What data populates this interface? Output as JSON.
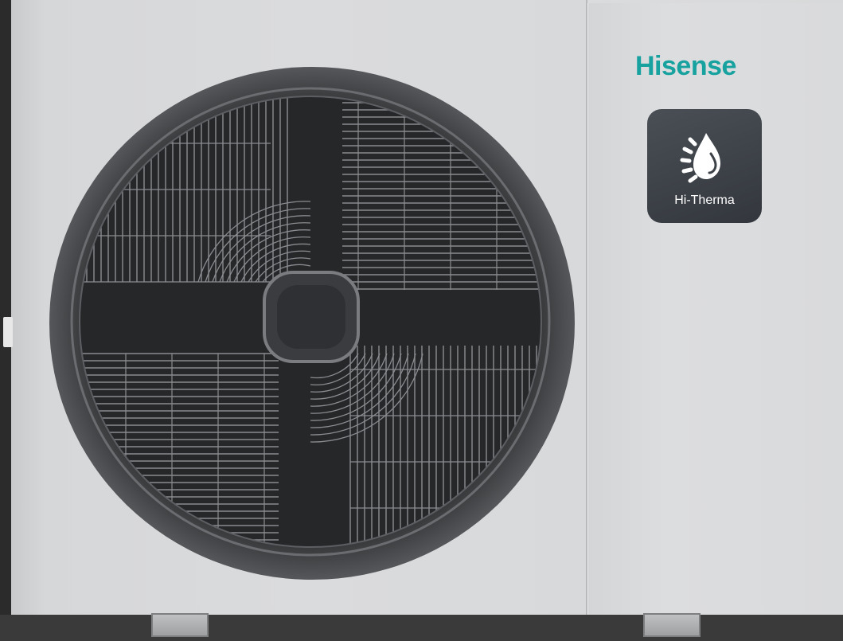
{
  "product": {
    "brand": "Hisense",
    "series_label": "Hi-Therma"
  },
  "colors": {
    "brand": "#17a2a0",
    "casing": "#dadbdd",
    "fan_grille": "#2e2f31",
    "badge": "#3d4248"
  },
  "icons": {
    "badge_icon": "water-drop-heat-icon"
  }
}
